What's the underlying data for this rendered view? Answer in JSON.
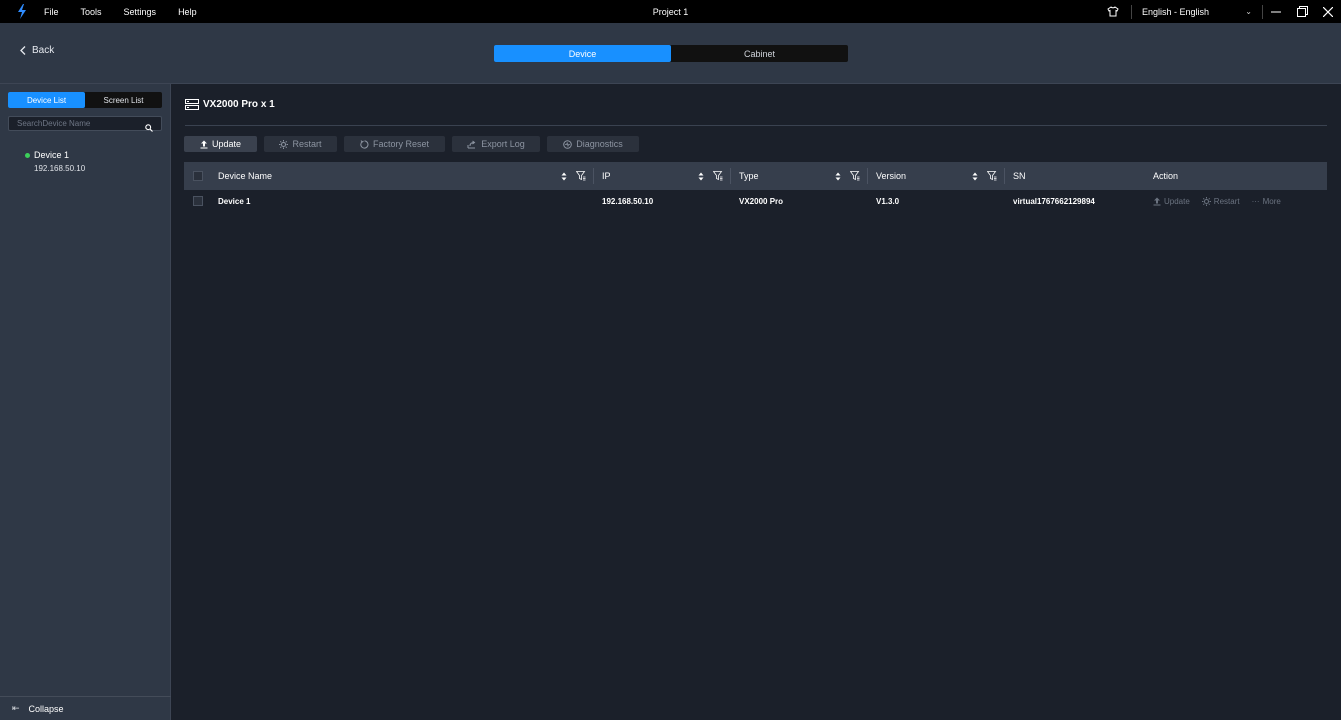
{
  "titlebar": {
    "menu": [
      "File",
      "Tools",
      "Settings",
      "Help"
    ],
    "title": "Project 1",
    "language": "English - English"
  },
  "header": {
    "back_label": "Back",
    "tabs": [
      "Device",
      "Cabinet"
    ],
    "active_tab": "Device"
  },
  "sidebar": {
    "tabs": [
      "Device List",
      "Screen List"
    ],
    "search_placeholder": "SearchDevice Name",
    "devices": [
      {
        "name": "Device 1",
        "ip": "192.168.50.10",
        "status_color": "#3ccf5a"
      }
    ],
    "collapse_label": "Collapse"
  },
  "main": {
    "model_title": "VX2000 Pro x 1",
    "toolbar": {
      "update": "Update",
      "restart": "Restart",
      "factory_reset": "Factory Reset",
      "export_log": "Export Log",
      "diagnostics": "Diagnostics"
    },
    "table": {
      "columns": [
        "Device Name",
        "IP",
        "Type",
        "Version",
        "SN",
        "Action"
      ],
      "rows": [
        {
          "name": "Device 1",
          "ip": "192.168.50.10",
          "type": "VX2000 Pro",
          "version": "V1.3.0",
          "sn": "virtual1767662129894"
        }
      ],
      "row_actions": {
        "update": "Update",
        "restart": "Restart",
        "more": "More"
      }
    }
  },
  "colors": {
    "accent": "#1890ff",
    "status_online": "#3ccf5a"
  }
}
